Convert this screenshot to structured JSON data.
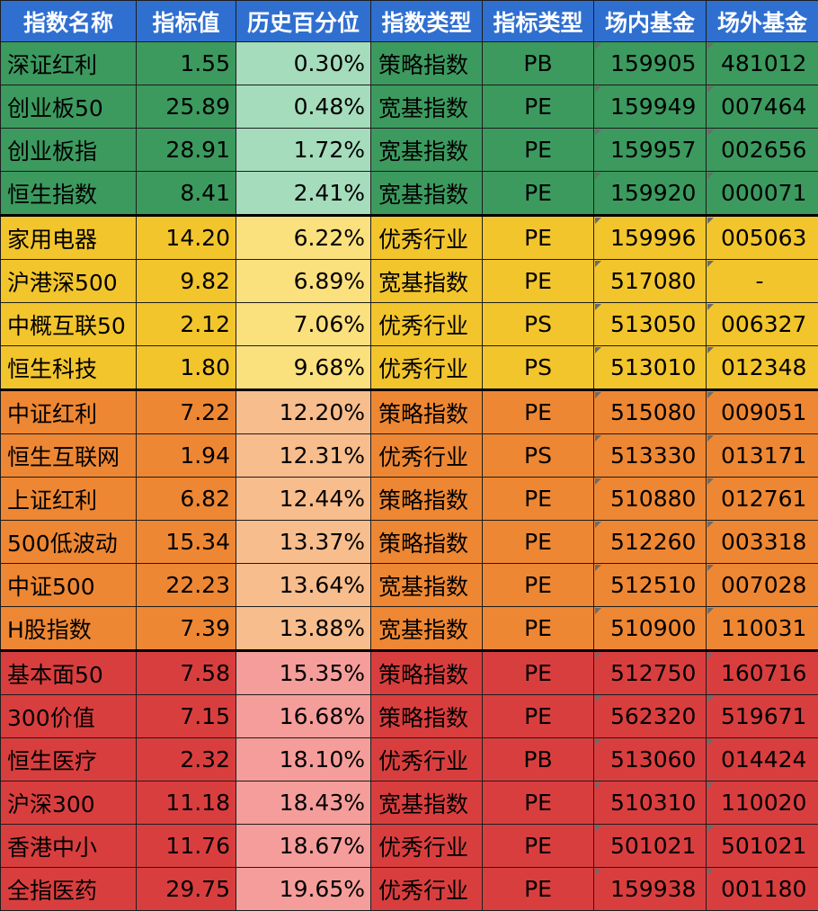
{
  "headers": [
    "指数名称",
    "指标值",
    "历史百分位",
    "指数类型",
    "指标类型",
    "场内基金",
    "场外基金"
  ],
  "rows": [
    {
      "name": "深证红利",
      "value": "1.55",
      "percentile": "0.30%",
      "index_type": "策略指数",
      "metric": "PB",
      "onsite": "159905",
      "offsite": "481012",
      "group": 1
    },
    {
      "name": "创业板50",
      "value": "25.89",
      "percentile": "0.48%",
      "index_type": "宽基指数",
      "metric": "PE",
      "onsite": "159949",
      "offsite": "007464",
      "group": 1
    },
    {
      "name": "创业板指",
      "value": "28.91",
      "percentile": "1.72%",
      "index_type": "宽基指数",
      "metric": "PE",
      "onsite": "159957",
      "offsite": "002656",
      "group": 1
    },
    {
      "name": "恒生指数",
      "value": "8.41",
      "percentile": "2.41%",
      "index_type": "宽基指数",
      "metric": "PE",
      "onsite": "159920",
      "offsite": "000071",
      "group": 1
    },
    {
      "name": "家用电器",
      "value": "14.20",
      "percentile": "6.22%",
      "index_type": "优秀行业",
      "metric": "PE",
      "onsite": "159996",
      "offsite": "005063",
      "group": 2
    },
    {
      "name": "沪港深500",
      "value": "9.82",
      "percentile": "6.89%",
      "index_type": "宽基指数",
      "metric": "PE",
      "onsite": "517080",
      "offsite": "-",
      "group": 2
    },
    {
      "name": "中概互联50",
      "value": "2.12",
      "percentile": "7.06%",
      "index_type": "优秀行业",
      "metric": "PS",
      "onsite": "513050",
      "offsite": "006327",
      "group": 2
    },
    {
      "name": "恒生科技",
      "value": "1.80",
      "percentile": "9.68%",
      "index_type": "优秀行业",
      "metric": "PS",
      "onsite": "513010",
      "offsite": "012348",
      "group": 2
    },
    {
      "name": "中证红利",
      "value": "7.22",
      "percentile": "12.20%",
      "index_type": "策略指数",
      "metric": "PE",
      "onsite": "515080",
      "offsite": "009051",
      "group": 3
    },
    {
      "name": "恒生互联网",
      "value": "1.94",
      "percentile": "12.31%",
      "index_type": "优秀行业",
      "metric": "PS",
      "onsite": "513330",
      "offsite": "013171",
      "group": 3
    },
    {
      "name": "上证红利",
      "value": "6.82",
      "percentile": "12.44%",
      "index_type": "策略指数",
      "metric": "PE",
      "onsite": "510880",
      "offsite": "012761",
      "group": 3
    },
    {
      "name": "500低波动",
      "value": "15.34",
      "percentile": "13.37%",
      "index_type": "策略指数",
      "metric": "PE",
      "onsite": "512260",
      "offsite": "003318",
      "group": 3
    },
    {
      "name": "中证500",
      "value": "22.23",
      "percentile": "13.64%",
      "index_type": "宽基指数",
      "metric": "PE",
      "onsite": "512510",
      "offsite": "007028",
      "group": 3
    },
    {
      "name": "H股指数",
      "value": "7.39",
      "percentile": "13.88%",
      "index_type": "宽基指数",
      "metric": "PE",
      "onsite": "510900",
      "offsite": "110031",
      "group": 3
    },
    {
      "name": "基本面50",
      "value": "7.58",
      "percentile": "15.35%",
      "index_type": "策略指数",
      "metric": "PE",
      "onsite": "512750",
      "offsite": "160716",
      "group": 4
    },
    {
      "name": "300价值",
      "value": "7.15",
      "percentile": "16.68%",
      "index_type": "策略指数",
      "metric": "PE",
      "onsite": "562320",
      "offsite": "519671",
      "group": 4
    },
    {
      "name": "恒生医疗",
      "value": "2.32",
      "percentile": "18.10%",
      "index_type": "优秀行业",
      "metric": "PB",
      "onsite": "513060",
      "offsite": "014424",
      "group": 4
    },
    {
      "name": "沪深300",
      "value": "11.18",
      "percentile": "18.43%",
      "index_type": "宽基指数",
      "metric": "PE",
      "onsite": "510310",
      "offsite": "110020",
      "group": 4
    },
    {
      "name": "香港中小",
      "value": "11.76",
      "percentile": "18.67%",
      "index_type": "优秀行业",
      "metric": "PE",
      "onsite": "501021",
      "offsite": "501021",
      "group": 4
    },
    {
      "name": "全指医药",
      "value": "29.75",
      "percentile": "19.65%",
      "index_type": "优秀行业",
      "metric": "PE",
      "onsite": "159938",
      "offsite": "001180",
      "group": 4
    }
  ]
}
